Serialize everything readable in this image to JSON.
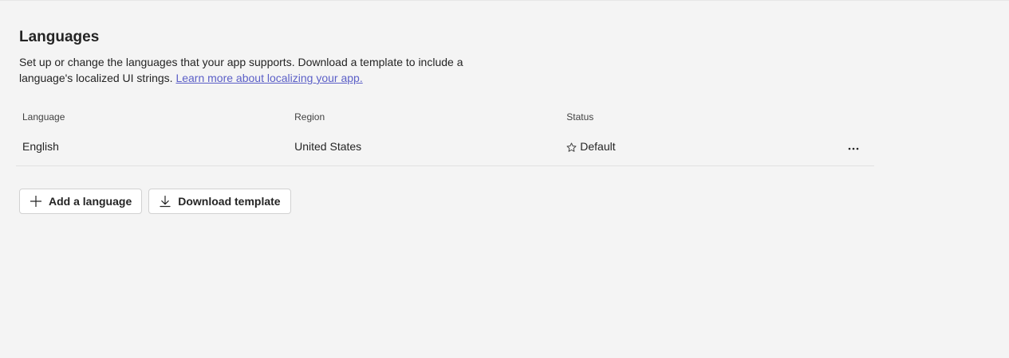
{
  "header": {
    "title": "Languages",
    "description": "Set up or change the languages that your app supports. Download a template to include a language's localized UI strings. ",
    "learn_more_link": "Learn more about localizing your app."
  },
  "table": {
    "columns": [
      "Language",
      "Region",
      "Status"
    ],
    "rows": [
      {
        "language": "English",
        "region": "United States",
        "status": "Default"
      }
    ]
  },
  "actions": {
    "add_language": "Add a language",
    "download_template": "Download template"
  },
  "icons": {
    "status": "star-icon",
    "more": "more-options-icon",
    "add": "plus-icon",
    "download": "download-icon"
  },
  "colors": {
    "background": "#f4f4f4",
    "link": "#5b5fc7",
    "text": "#242424"
  }
}
